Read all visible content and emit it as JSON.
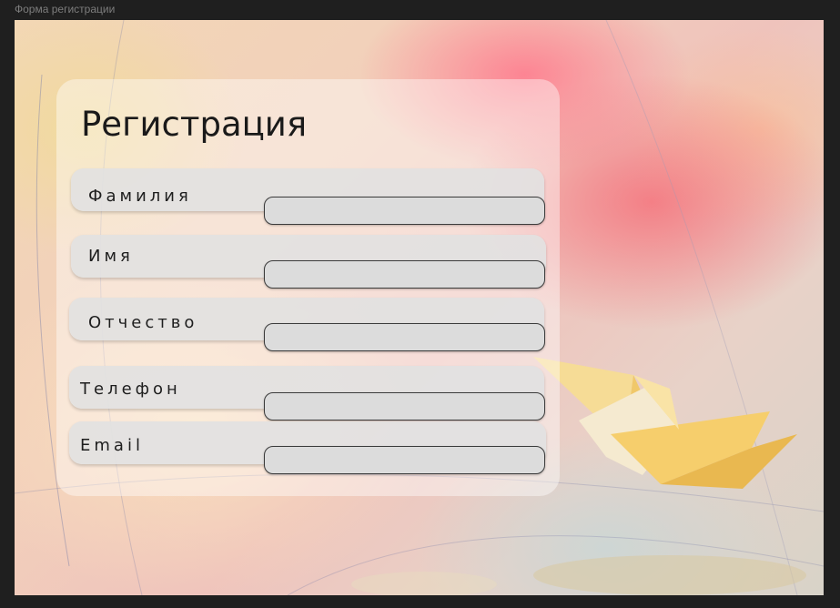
{
  "window": {
    "title": "Форма регистрации"
  },
  "form": {
    "title": "Регистрация",
    "fields": [
      {
        "label": "Фамилия",
        "value": ""
      },
      {
        "label": "Имя",
        "value": ""
      },
      {
        "label": "Отчество",
        "value": ""
      },
      {
        "label": "Телефон",
        "value": ""
      },
      {
        "label": "Email",
        "value": ""
      }
    ]
  },
  "colors": {
    "panel": "#ffffff",
    "row": "#e1e1e1",
    "field": "#dcdcdc",
    "boat": "#f6d27a"
  }
}
